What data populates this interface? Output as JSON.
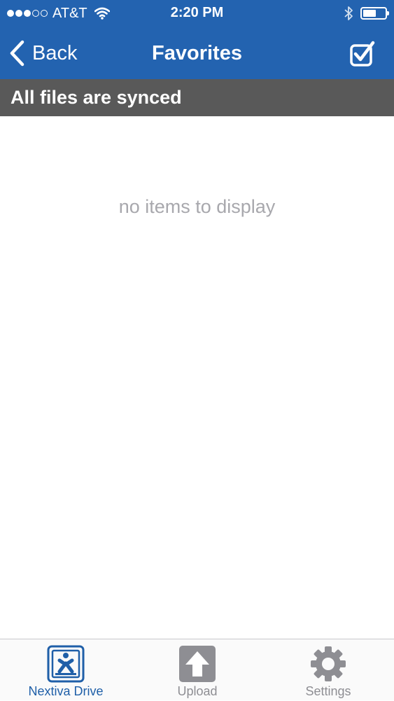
{
  "status_bar": {
    "carrier": "AT&T",
    "time": "2:20 PM",
    "signal_bars_filled": 3,
    "signal_bars_total": 5,
    "battery_level": 0.5
  },
  "nav": {
    "back_label": "Back",
    "title": "Favorites",
    "select_icon": "checkbox-icon"
  },
  "sync_banner": {
    "text": "All files are synced"
  },
  "content": {
    "empty_message": "no items to display"
  },
  "tabs": [
    {
      "label": "Nextiva Drive",
      "icon": "nextiva-drive-icon",
      "active": true
    },
    {
      "label": "Upload",
      "icon": "upload-icon",
      "active": false
    },
    {
      "label": "Settings",
      "icon": "gear-icon",
      "active": false
    }
  ],
  "colors": {
    "header": "#2363b0",
    "banner": "#595959",
    "tab_active": "#1f5fa8",
    "tab_inactive": "#8e8e93"
  }
}
